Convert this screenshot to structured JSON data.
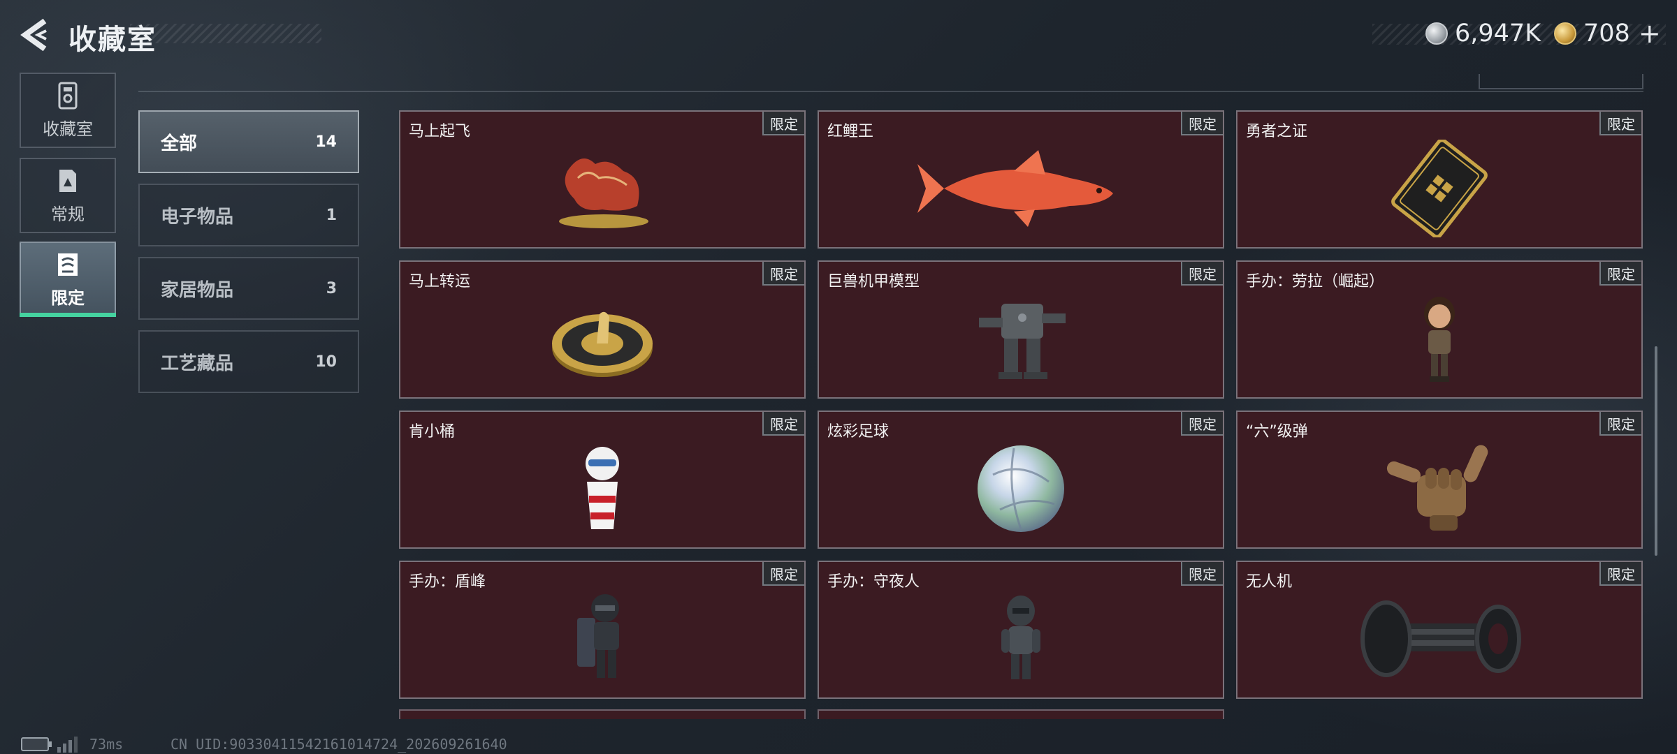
{
  "header": {
    "title": "收藏室",
    "currencies": [
      {
        "name": "silver-coin",
        "amount": "6,947K"
      },
      {
        "name": "gold-coin",
        "amount": "708"
      }
    ],
    "add_label": "+"
  },
  "side_tabs": [
    {
      "label": "收藏室",
      "icon": "collection-room-icon",
      "active": false
    },
    {
      "label": "常规",
      "icon": "regular-icon",
      "active": false
    },
    {
      "label": "限定",
      "icon": "limited-icon",
      "active": true
    }
  ],
  "categories": [
    {
      "label": "全部",
      "count": "14",
      "active": true
    },
    {
      "label": "电子物品",
      "count": "1",
      "active": false
    },
    {
      "label": "家居物品",
      "count": "3",
      "active": false
    },
    {
      "label": "工艺藏品",
      "count": "10",
      "active": false
    }
  ],
  "limited_badge": "限定",
  "items": [
    {
      "name": "马上起飞",
      "icon": "horse-statue-icon"
    },
    {
      "name": "红鲤王",
      "icon": "red-carp-icon"
    },
    {
      "name": "勇者之证",
      "icon": "hero-card-icon"
    },
    {
      "name": "马上转运",
      "icon": "fortune-wheel-icon"
    },
    {
      "name": "巨兽机甲模型",
      "icon": "mech-model-icon"
    },
    {
      "name": "手办：劳拉（崛起）",
      "icon": "lara-figure-icon"
    },
    {
      "name": "肯小桶",
      "icon": "kfc-bucket-figure-icon"
    },
    {
      "name": "炫彩足球",
      "icon": "iridescent-ball-icon"
    },
    {
      "name": "“六”级弹",
      "icon": "shaka-hand-icon"
    },
    {
      "name": "手办：盾峰",
      "icon": "shield-soldier-figure-icon"
    },
    {
      "name": "手办：守夜人",
      "icon": "nightwatch-figure-icon"
    },
    {
      "name": "无人机",
      "icon": "drone-icon"
    }
  ],
  "footer": {
    "ping": "73ms",
    "uid": "CN UID:90330411542161014724_202609261640"
  },
  "colors": {
    "accent_green": "#45d3a0",
    "card_bg": "#3b1b22",
    "badge_bg": "#2a2d31"
  }
}
